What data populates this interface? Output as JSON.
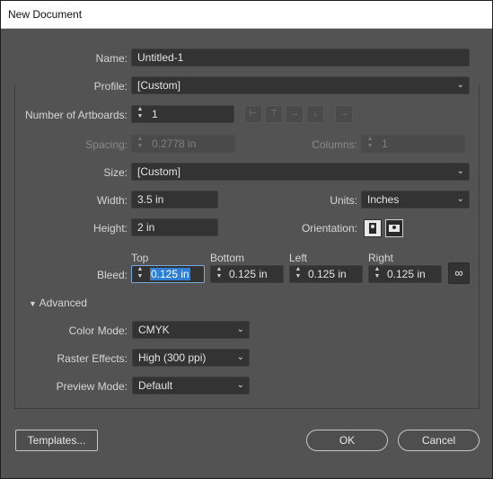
{
  "window": {
    "title": "New Document"
  },
  "name": {
    "label": "Name:",
    "value": "Untitled-1"
  },
  "profile": {
    "label": "Profile:",
    "value": "[Custom]"
  },
  "artboards": {
    "label": "Number of Artboards:",
    "value": "1",
    "icons": [
      "grid-by-row-icon",
      "grid-by-column-icon",
      "arrange-by-row-icon",
      "arrange-by-column-icon",
      "right-to-left-icon"
    ]
  },
  "spacing": {
    "label": "Spacing:",
    "value": "0.2778 in"
  },
  "columns": {
    "label": "Columns:",
    "value": "1"
  },
  "size": {
    "label": "Size:",
    "value": "[Custom]"
  },
  "width": {
    "label": "Width:",
    "value": "3.5 in"
  },
  "units": {
    "label": "Units:",
    "value": "Inches"
  },
  "height": {
    "label": "Height:",
    "value": "2 in"
  },
  "orientation": {
    "label": "Orientation:",
    "selected": "landscape"
  },
  "bleed": {
    "label": "Bleed:",
    "headers": {
      "top": "Top",
      "bottom": "Bottom",
      "left": "Left",
      "right": "Right"
    },
    "top": "0.125 in",
    "bottom": "0.125 in",
    "left": "0.125 in",
    "right": "0.125 in",
    "link_icon": "chain-link-icon"
  },
  "advanced": {
    "toggle_label": "Advanced",
    "color_mode": {
      "label": "Color Mode:",
      "value": "CMYK"
    },
    "raster_effects": {
      "label": "Raster Effects:",
      "value": "High (300 ppi)"
    },
    "preview_mode": {
      "label": "Preview Mode:",
      "value": "Default"
    }
  },
  "buttons": {
    "templates": "Templates...",
    "ok": "OK",
    "cancel": "Cancel"
  },
  "colors": {
    "background": "#535353",
    "field": "#333333",
    "selection": "#2f7fd6"
  }
}
